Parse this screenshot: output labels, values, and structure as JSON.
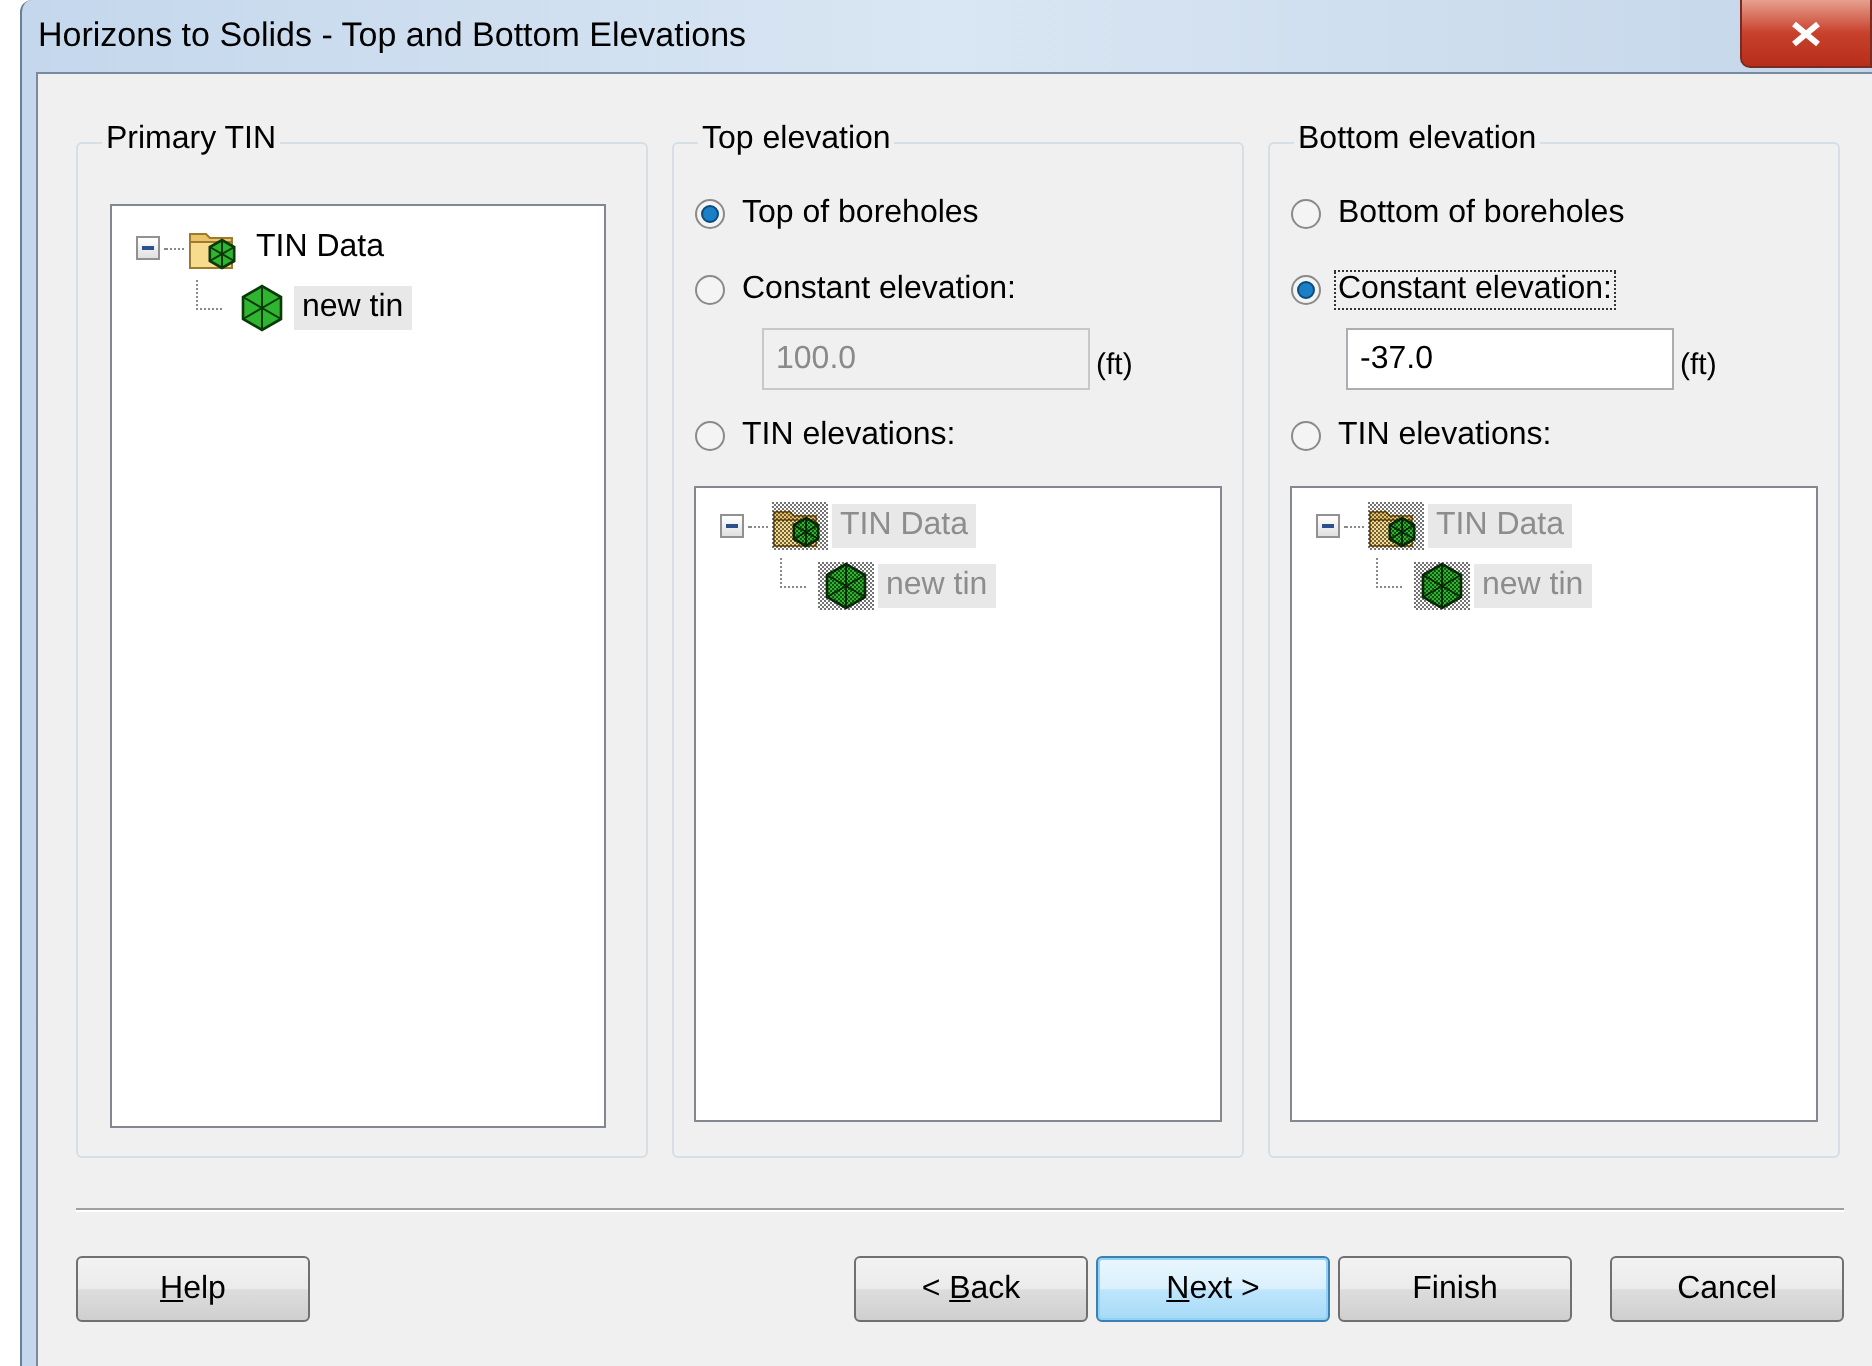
{
  "window": {
    "title": "Horizons to Solids - Top and Bottom Elevations"
  },
  "groups": [
    {
      "kind": "tree",
      "title": "Primary TIN",
      "tree": {
        "disabled": false,
        "items": [
          {
            "label": "TIN Data",
            "kind": "folder-node",
            "expanded": true,
            "selected": false,
            "children": [
              {
                "label": "new tin",
                "kind": "tin-node",
                "selected": true
              }
            ]
          }
        ]
      }
    },
    {
      "kind": "options",
      "title": "Top elevation",
      "options": [
        {
          "kind": "radio",
          "label": "Top of boreholes",
          "selected": true,
          "focused": false
        },
        {
          "kind": "radio",
          "label": "Constant elevation:",
          "selected": false,
          "focused": false
        },
        {
          "kind": "field",
          "value": "100.0",
          "disabled": true,
          "unit": "(ft)"
        },
        {
          "kind": "radio",
          "label": "TIN elevations:",
          "selected": false,
          "focused": false
        },
        {
          "kind": "tree",
          "disabled": true,
          "items": [
            {
              "label": "TIN Data",
              "kind": "folder-node",
              "expanded": true,
              "selected": true,
              "children": [
                {
                  "label": "new tin",
                  "kind": "tin-node",
                  "selected": true
                }
              ]
            }
          ]
        }
      ]
    },
    {
      "kind": "options",
      "title": "Bottom elevation",
      "options": [
        {
          "kind": "radio",
          "label": "Bottom of boreholes",
          "selected": false,
          "focused": false
        },
        {
          "kind": "radio",
          "label": "Constant elevation:",
          "selected": true,
          "focused": true
        },
        {
          "kind": "field",
          "value": "-37.0",
          "disabled": false,
          "unit": "(ft)"
        },
        {
          "kind": "radio",
          "label": "TIN elevations:",
          "selected": false,
          "focused": false
        },
        {
          "kind": "tree",
          "disabled": true,
          "items": [
            {
              "label": "TIN Data",
              "kind": "folder-node",
              "expanded": true,
              "selected": true,
              "children": [
                {
                  "label": "new tin",
                  "kind": "tin-node",
                  "selected": true
                }
              ]
            }
          ]
        }
      ]
    }
  ],
  "buttons": [
    {
      "key": "H",
      "post": "elp",
      "focused": false
    },
    {
      "pre": "< ",
      "key": "B",
      "post": "ack",
      "focused": false
    },
    {
      "key": "N",
      "post": "ext >",
      "focused": true
    },
    {
      "pre": "Finish",
      "focused": false
    },
    {
      "pre": "Cancel",
      "focused": false
    }
  ]
}
